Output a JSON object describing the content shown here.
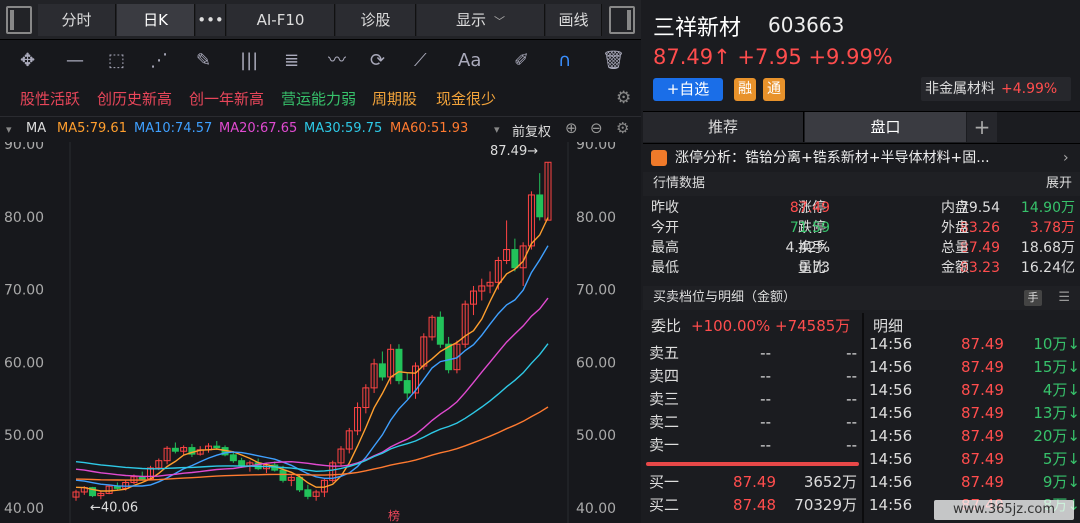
{
  "topbar": {
    "btn_fenshi": "分时",
    "btn_rik": "日K",
    "btn_more": "•••",
    "btn_f10": "AI-F10",
    "btn_zhengu": "诊股",
    "btn_display": "显示",
    "btn_draw": "画线"
  },
  "toolbar_icons": [
    "crosshair-icon",
    "line-icon",
    "rect-icon",
    "fan-icon",
    "pen-icon",
    "bars-icon",
    "channel-icon",
    "wave-icon",
    "cycle-icon",
    "gann-icon",
    "text-icon",
    "eraser-icon",
    "magnet-icon",
    "trash-icon"
  ],
  "tags": [
    "股性活跃",
    "创历史新高",
    "创一年新高",
    "营运能力弱",
    "周期股",
    "现金很少"
  ],
  "ma": {
    "label": "MA",
    "ma5": "MA5:79.61",
    "ma10": "MA10:74.57",
    "ma20": "MA20:67.65",
    "ma30": "MA30:59.75",
    "ma60": "MA60:51.93",
    "fuquan": "前复权"
  },
  "chart_data": {
    "type": "candlestick",
    "y_ticks": [
      "90.00",
      "80.00",
      "70.00",
      "60.00",
      "50.00",
      "40.00"
    ],
    "ylim": [
      40,
      90
    ],
    "high_label": "87.49→",
    "low_label": "←40.06",
    "marker": "榜",
    "colors": {
      "up": "#ff4444",
      "down": "#22c25a",
      "ma5": "#ff9f2e",
      "ma10": "#3fa0ff",
      "ma20": "#e04ad0",
      "ma30": "#2ec9e6",
      "ma60": "#ff7a30"
    },
    "candles": [
      [
        41.5,
        42.5,
        41.0,
        42.2
      ],
      [
        42.2,
        43.0,
        41.8,
        42.8
      ],
      [
        42.8,
        42.9,
        41.5,
        41.7
      ],
      [
        41.7,
        42.4,
        41.2,
        42.0
      ],
      [
        42.0,
        43.2,
        41.9,
        43.0
      ],
      [
        43.0,
        43.5,
        42.5,
        42.7
      ],
      [
        42.7,
        43.8,
        42.4,
        43.5
      ],
      [
        43.5,
        44.6,
        43.3,
        44.3
      ],
      [
        44.3,
        45.0,
        43.8,
        44.0
      ],
      [
        44.0,
        45.8,
        43.9,
        45.5
      ],
      [
        45.5,
        46.8,
        45.2,
        46.5
      ],
      [
        46.5,
        48.5,
        46.0,
        48.2
      ],
      [
        48.2,
        49.0,
        47.5,
        47.8
      ],
      [
        47.8,
        48.6,
        47.2,
        48.3
      ],
      [
        48.3,
        48.8,
        47.0,
        47.4
      ],
      [
        47.4,
        48.5,
        47.2,
        48.0
      ],
      [
        48.0,
        48.9,
        47.6,
        48.5
      ],
      [
        48.5,
        49.2,
        48.0,
        48.3
      ],
      [
        48.3,
        48.6,
        47.1,
        47.3
      ],
      [
        47.3,
        47.8,
        46.2,
        46.5
      ],
      [
        46.5,
        46.9,
        45.5,
        45.8
      ],
      [
        45.8,
        46.5,
        45.0,
        46.2
      ],
      [
        46.2,
        46.8,
        45.2,
        45.4
      ],
      [
        45.4,
        46.2,
        44.8,
        45.9
      ],
      [
        45.9,
        46.4,
        45.0,
        45.2
      ],
      [
        45.2,
        45.8,
        43.5,
        43.8
      ],
      [
        43.8,
        44.5,
        43.0,
        44.2
      ],
      [
        44.2,
        44.6,
        42.2,
        42.5
      ],
      [
        42.5,
        43.2,
        41.2,
        41.6
      ],
      [
        41.6,
        42.5,
        41.0,
        42.2
      ],
      [
        42.2,
        44.0,
        41.5,
        43.8
      ],
      [
        43.8,
        46.5,
        43.5,
        46.2
      ],
      [
        46.2,
        48.5,
        45.8,
        48.1
      ],
      [
        48.1,
        51.0,
        47.5,
        50.6
      ],
      [
        50.6,
        54.5,
        50.0,
        53.8
      ],
      [
        53.8,
        57.0,
        53.0,
        56.5
      ],
      [
        56.5,
        60.5,
        55.8,
        59.8
      ],
      [
        59.8,
        61.5,
        57.5,
        58.0
      ],
      [
        58.0,
        62.5,
        57.0,
        61.8
      ],
      [
        61.8,
        62.5,
        57.0,
        57.5
      ],
      [
        57.5,
        58.5,
        55.0,
        55.8
      ],
      [
        55.8,
        60.0,
        55.0,
        59.5
      ],
      [
        59.5,
        64.0,
        59.0,
        63.5
      ],
      [
        63.5,
        66.5,
        63.0,
        66.2
      ],
      [
        66.2,
        67.0,
        62.0,
        62.5
      ],
      [
        62.5,
        63.5,
        58.5,
        59.0
      ],
      [
        59.0,
        63.0,
        58.5,
        62.5
      ],
      [
        62.5,
        68.5,
        62.0,
        68.0
      ],
      [
        68.0,
        70.5,
        66.5,
        69.8
      ],
      [
        69.8,
        71.5,
        68.5,
        70.5
      ],
      [
        70.5,
        72.5,
        69.5,
        71.0
      ],
      [
        71.0,
        74.5,
        70.0,
        74.0
      ],
      [
        74.0,
        79.5,
        73.5,
        75.5
      ],
      [
        75.5,
        77.0,
        72.5,
        73.0
      ],
      [
        73.0,
        76.5,
        70.5,
        76.0
      ],
      [
        76.0,
        83.5,
        75.5,
        83.0
      ],
      [
        83.0,
        86.0,
        79.5,
        80.0
      ],
      [
        79.54,
        87.49,
        79.5,
        87.49
      ]
    ]
  },
  "stock": {
    "name": "三祥新材",
    "code": "603663",
    "price": "87.49↑",
    "change": "+7.95",
    "change_pct": "+9.99%",
    "add_btn": "+自选",
    "badge1": "融",
    "badge2": "通",
    "sector": "非金属材料",
    "sector_pct": "+4.99%"
  },
  "tabs": {
    "t1": "推荐",
    "t2": "盘口",
    "plus": "+"
  },
  "analysis": {
    "text": "涨停分析：锆铪分离+锆系新材+半导体材料+固...",
    "arrow": "›"
  },
  "quote": {
    "header": "行情数据",
    "expand": "展开",
    "rows": [
      {
        "l1": "昨收",
        "v1": "79.54",
        "l2": "涨停",
        "v2": "87.49",
        "l3": "内盘",
        "v3": "14.90万"
      },
      {
        "l1": "今开",
        "v1": "83.26",
        "l2": "跌停",
        "v2": "71.59",
        "l3": "外盘",
        "v3": "3.78万"
      },
      {
        "l1": "最高",
        "v1": "87.49",
        "l2": "换手",
        "v2": "4.42%",
        "l3": "总量",
        "v3": "18.68万"
      },
      {
        "l1": "最低",
        "v1": "83.23",
        "l2": "量比",
        "v2": "0.73",
        "l3": "金额",
        "v3": "16.24亿"
      }
    ]
  },
  "orderbook": {
    "header": "买卖档位与明细（金额）",
    "hand_btn": "手",
    "ratio_label": "委比",
    "ratio_val": "+100.00%",
    "ratio_amt": "+74585万",
    "detail_label": "明细",
    "sells": [
      {
        "label": "卖五",
        "price": "--",
        "vol": "--"
      },
      {
        "label": "卖四",
        "price": "--",
        "vol": "--"
      },
      {
        "label": "卖三",
        "price": "--",
        "vol": "--"
      },
      {
        "label": "卖二",
        "price": "--",
        "vol": "--"
      },
      {
        "label": "卖一",
        "price": "--",
        "vol": "--"
      }
    ],
    "buys": [
      {
        "label": "买一",
        "price": "87.49",
        "vol": "3652万"
      },
      {
        "label": "买二",
        "price": "87.48",
        "vol": "70329万"
      }
    ],
    "details": [
      {
        "time": "14:56",
        "price": "87.49",
        "vol": "10万↓"
      },
      {
        "time": "14:56",
        "price": "87.49",
        "vol": "15万↓"
      },
      {
        "time": "14:56",
        "price": "87.49",
        "vol": "4万↓"
      },
      {
        "time": "14:56",
        "price": "87.49",
        "vol": "13万↓"
      },
      {
        "time": "14:56",
        "price": "87.49",
        "vol": "20万↓"
      },
      {
        "time": "14:56",
        "price": "87.49",
        "vol": "5万↓"
      },
      {
        "time": "14:56",
        "price": "87.49",
        "vol": "9万↓"
      },
      {
        "time": "14:56",
        "price": "87.49",
        "vol": "8万↓"
      }
    ]
  },
  "watermark": "www.365jz.com"
}
